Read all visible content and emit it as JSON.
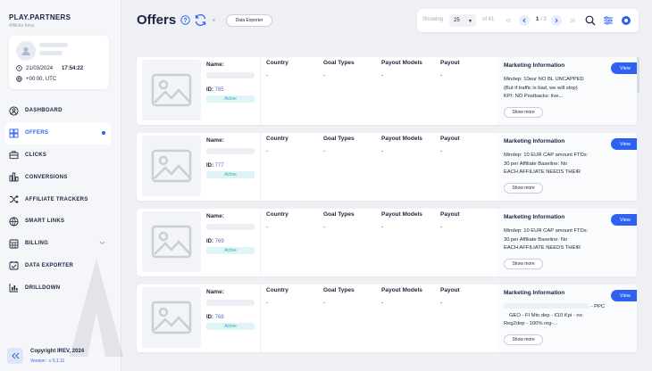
{
  "sidebar": {
    "brand": "PLAY.PARTNERS",
    "brand_sub": "Affiliate Area",
    "user": {
      "date": "21/03/2024",
      "time": "17:54:22",
      "timezone": "+00:00, UTC"
    },
    "items": [
      {
        "label": "DASHBOARD",
        "icon": "user-circle-icon"
      },
      {
        "label": "OFFERS",
        "icon": "offers-icon"
      },
      {
        "label": "CLICKS",
        "icon": "briefcase-icon"
      },
      {
        "label": "CONVERSIONS",
        "icon": "conversions-icon"
      },
      {
        "label": "AFFILIATE TRACKERS",
        "icon": "shuffle-icon"
      },
      {
        "label": "SMART LINKS",
        "icon": "globe-icon"
      },
      {
        "label": "BILLING",
        "icon": "billing-icon"
      },
      {
        "label": "DATA EXPORTER",
        "icon": "data-exporter-icon"
      },
      {
        "label": "DRILLDOWN",
        "icon": "drilldown-icon"
      }
    ],
    "copyright": "Copyright IREV, 2024",
    "version": "Version : v 0.1.11"
  },
  "header": {
    "title": "Offers",
    "data_exporter_label": "Data Exporter"
  },
  "pagination": {
    "showing_label": "Showing",
    "per_page": "25",
    "of_label": "of 61",
    "page_current": "1",
    "page_total": "/ 3"
  },
  "columns": {
    "name": "Name:",
    "country": "Country",
    "goal_types": "Goal Types",
    "payout_models": "Payout Models",
    "payout": "Payout",
    "marketing": "Marketing Information",
    "id_label": "ID:",
    "placeholder": "-"
  },
  "offers": [
    {
      "id": "785",
      "status": "Active",
      "marketing_lines": [
        "Mindep: 10eur  NO BL  UNCAPPED",
        "(But if traffic is bad, we will stop)",
        "KPI: NO    Postbacks: live..."
      ],
      "show_more": "Show more",
      "view": "View"
    },
    {
      "id": "777",
      "status": "Active",
      "marketing_lines": [
        "Mindep: 10 EUR  CAP amount FTDs:",
        "30 per Affiliate  Baseline: No",
        "EACH AFFILIATE NEEDS THEIR"
      ],
      "show_more": "Show more",
      "view": "View"
    },
    {
      "id": "769",
      "status": "Active",
      "marketing_lines": [
        "Mindep: 10 EUR  CAP amount FTDs:",
        "30 per Affiliate  Baseline: No",
        "EACH AFFILIATE NEEDS THEIR"
      ],
      "show_more": "Show more",
      "view": "View"
    },
    {
      "id": "768",
      "status": "Active",
      "marketing_lines": [
        "- PPC",
        "GEO - FI  Min dep - €10  Kpi - no",
        "Reg2dep - 100% reg-..."
      ],
      "show_more": "Show more",
      "view": "View"
    }
  ]
}
